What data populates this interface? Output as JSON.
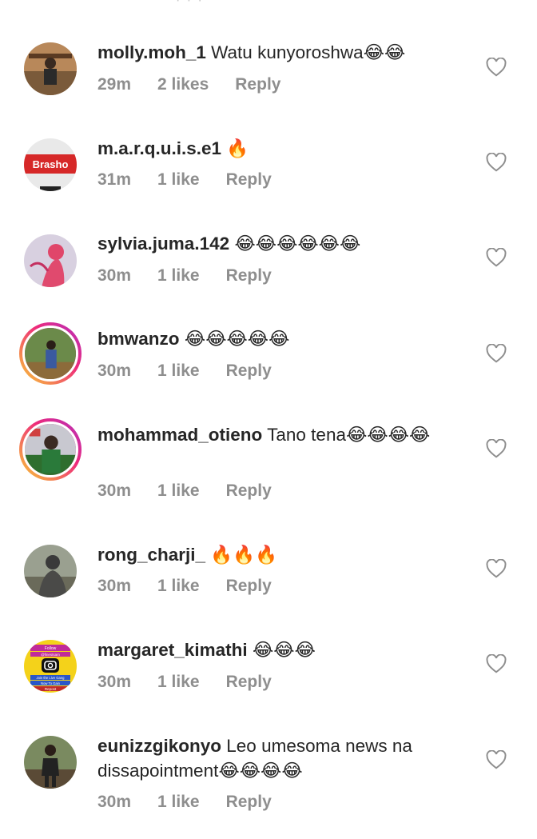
{
  "comments": [
    {
      "username": "molly.moh_1",
      "text": "Watu kunyoroshwa😂😂",
      "time": "29m",
      "likes": "2 likes",
      "reply": "Reply"
    },
    {
      "username": "m.a.r.q.u.i.s.e1",
      "text": "🔥",
      "time": "31m",
      "likes": "1 like",
      "reply": "Reply",
      "avatar_text": "Brasho"
    },
    {
      "username": "sylvia.juma.142",
      "text": "😂😂😂😂😂😂",
      "time": "30m",
      "likes": "1 like",
      "reply": "Reply"
    },
    {
      "username": "bmwanzo",
      "text": "😂😂😂😂😂",
      "time": "30m",
      "likes": "1 like",
      "reply": "Reply"
    },
    {
      "username": "mohammad_otieno",
      "text": "Tano tena😂😂😂😂",
      "time": "30m",
      "likes": "1 like",
      "reply": "Reply"
    },
    {
      "username": "rong_charji_",
      "text": "🔥🔥🔥",
      "time": "30m",
      "likes": "1 like",
      "reply": "Reply"
    },
    {
      "username": "margaret_kimathi",
      "text": "😂😂😂",
      "time": "30m",
      "likes": "1 like",
      "reply": "Reply",
      "avatar_text": [
        "Follow",
        "@finestsam",
        "Join the Live Gang",
        "Now To Gain",
        "Repost"
      ]
    },
    {
      "username": "eunizzgikonyo",
      "text": "Leo umesoma news na dissapointment😂😂😂😂",
      "time": "30m",
      "likes": "1 like",
      "reply": "Reply"
    }
  ],
  "icons": {
    "like": "heart-outline-icon",
    "avatar": "profile-photo"
  },
  "colors": {
    "text": "#262626",
    "meta": "#8e8e8e",
    "heart": "#8e8e8e",
    "story_ring_start": "#f9ce34",
    "story_ring_end": "#ee2a7b"
  }
}
